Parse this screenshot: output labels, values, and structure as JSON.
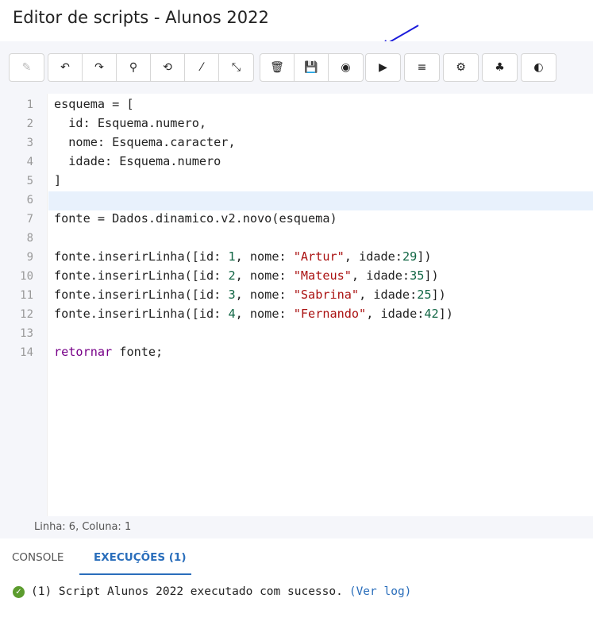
{
  "title": "Editor de scripts - Alunos 2022",
  "toolbar": {
    "groups": [
      [
        {
          "icon": "pencil-icon",
          "glyph": "✎",
          "disabled": true
        }
      ],
      [
        {
          "icon": "undo-icon",
          "glyph": "↶"
        },
        {
          "icon": "redo-icon",
          "glyph": "↷"
        },
        {
          "icon": "search-icon",
          "glyph": "⚲"
        },
        {
          "icon": "search-replace-icon",
          "glyph": "⟲"
        },
        {
          "icon": "magic-wand-icon",
          "glyph": "⁄"
        },
        {
          "icon": "compress-icon",
          "glyph": "⤡"
        }
      ],
      [
        {
          "icon": "trash-icon",
          "glyph": "🗑"
        },
        {
          "icon": "save-icon",
          "glyph": "💾",
          "disabled": true
        },
        {
          "icon": "globe-icon",
          "glyph": "◉"
        }
      ],
      [
        {
          "icon": "play-icon",
          "glyph": "▶"
        }
      ],
      [
        {
          "icon": "format-icon",
          "glyph": "≡"
        }
      ],
      [
        {
          "icon": "gear-icon",
          "glyph": "⚙"
        }
      ],
      [
        {
          "icon": "sitemap-icon",
          "glyph": "♣"
        }
      ],
      [
        {
          "icon": "contrast-icon",
          "glyph": "◐"
        }
      ]
    ]
  },
  "editor": {
    "active_line": 6,
    "lines": [
      [
        [
          "t",
          "esquema = ["
        ]
      ],
      [
        [
          "t",
          "  id: Esquema.numero,"
        ]
      ],
      [
        [
          "t",
          "  nome: Esquema.caracter,"
        ]
      ],
      [
        [
          "t",
          "  idade: Esquema.numero"
        ]
      ],
      [
        [
          "t",
          "]"
        ]
      ],
      [],
      [
        [
          "t",
          "fonte = Dados.dinamico.v2.novo(esquema)"
        ]
      ],
      [],
      [
        [
          "t",
          "fonte.inserirLinha([id: "
        ],
        [
          "num",
          "1"
        ],
        [
          "t",
          ", nome: "
        ],
        [
          "str",
          "\"Artur\""
        ],
        [
          "t",
          ", idade:"
        ],
        [
          "num",
          "29"
        ],
        [
          "t",
          "])"
        ]
      ],
      [
        [
          "t",
          "fonte.inserirLinha([id: "
        ],
        [
          "num",
          "2"
        ],
        [
          "t",
          ", nome: "
        ],
        [
          "str",
          "\"Mateus\""
        ],
        [
          "t",
          ", idade:"
        ],
        [
          "num",
          "35"
        ],
        [
          "t",
          "])"
        ]
      ],
      [
        [
          "t",
          "fonte.inserirLinha([id: "
        ],
        [
          "num",
          "3"
        ],
        [
          "t",
          ", nome: "
        ],
        [
          "str",
          "\"Sabrina\""
        ],
        [
          "t",
          ", idade:"
        ],
        [
          "num",
          "25"
        ],
        [
          "t",
          "])"
        ]
      ],
      [
        [
          "t",
          "fonte.inserirLinha([id: "
        ],
        [
          "num",
          "4"
        ],
        [
          "t",
          ", nome: "
        ],
        [
          "str",
          "\"Fernando\""
        ],
        [
          "t",
          ", idade:"
        ],
        [
          "num",
          "42"
        ],
        [
          "t",
          "])"
        ]
      ],
      [],
      [
        [
          "kw",
          "retornar"
        ],
        [
          "t",
          " fonte;"
        ]
      ]
    ]
  },
  "status": "Linha: 6, Coluna: 1",
  "tabs": {
    "console": "CONSOLE",
    "executions": "EXECUÇÕES (1)"
  },
  "log": {
    "message": "(1) Script Alunos 2022 executado com sucesso.",
    "link": "(Ver log)"
  },
  "colors": {
    "accent": "#2a6ebb",
    "success": "#5c9c2e",
    "arrow": "#1a1adb"
  }
}
